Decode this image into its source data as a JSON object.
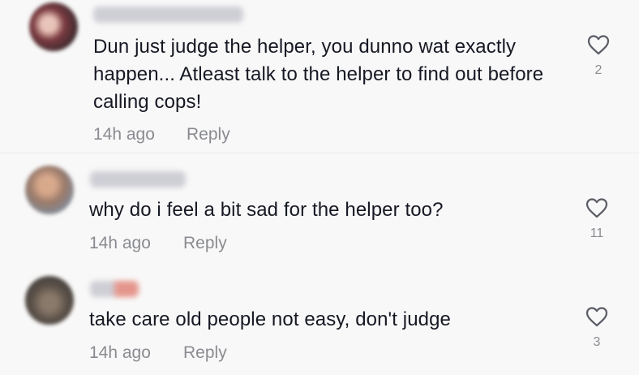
{
  "comments": [
    {
      "author": "Rebecca Seeni",
      "text": "Dun just judge the helper, you dunno wat exactly happen... Atleast talk to the helper to find out before calling cops!",
      "time": "14h ago",
      "reply_label": "Reply",
      "likes": "2",
      "avatar_color": "#a86a6a",
      "name_color": "#c9c9cf"
    },
    {
      "author": "Deon Tan",
      "text": "why do i feel a bit sad for the helper too?",
      "time": "14h ago",
      "reply_label": "Reply",
      "likes": "11",
      "avatar_color": "#b08870",
      "name_color": "#c9c9cf"
    },
    {
      "author": "Mi",
      "text": "take care old people not easy, don't judge",
      "time": "14h ago",
      "reply_label": "Reply",
      "likes": "3",
      "avatar_color": "#6b6158",
      "name_color": "#d98a80"
    }
  ]
}
